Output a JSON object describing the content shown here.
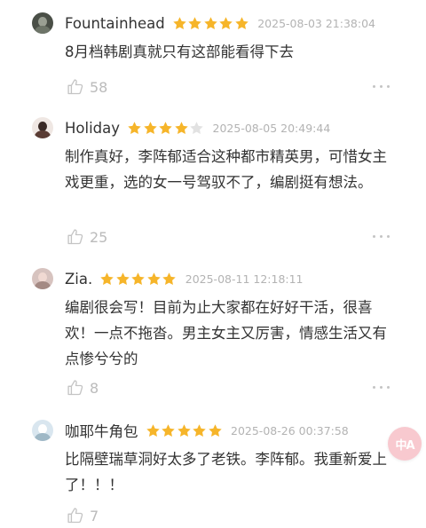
{
  "reviews": [
    {
      "username": "Fountainhead",
      "rating": 5,
      "date": "2025-08-03 21:38:04",
      "content": "8月档韩剧真就只有这部能看得下去",
      "likes": "58"
    },
    {
      "username": "Holiday",
      "rating": 4,
      "date": "2025-08-05 20:49:44",
      "content": "制作真好，李阵郁适合这种都市精英男，可惜女主戏更重，选的女一号驾驭不了，编剧挺有想法。",
      "likes": "25"
    },
    {
      "username": "Zia.",
      "rating": 5,
      "date": "2025-08-11 12:18:11",
      "content": "编剧很会写！目前为止大家都在好好干活，很喜欢！一点不拖沓。男主女主又厉害，情感生活又有点惨兮兮的",
      "likes": "8"
    },
    {
      "username": "咖耶牛角包",
      "rating": 5,
      "date": "2025-08-26 00:37:58",
      "content": "比隔壁瑞草洞好太多了老铁。李阵郁。我重新爱上了！！！",
      "likes": "7"
    }
  ],
  "floating_button": {
    "label": "中A",
    "icon": "translate-icon"
  },
  "colors": {
    "star_filled": "#f6b52a",
    "star_empty": "#e2e2e2",
    "floating_button": "#f8c9cf"
  }
}
